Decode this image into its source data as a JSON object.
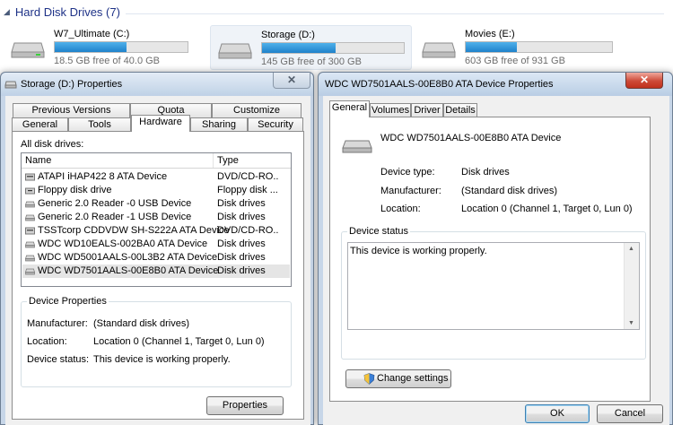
{
  "explorer": {
    "group_title": "Hard Disk Drives (7)",
    "drives": [
      {
        "name": "W7_Ultimate (C:)",
        "free_text": "18.5 GB free of 40.0 GB",
        "used_fraction": 0.54
      },
      {
        "name": "Storage (D:)",
        "free_text": "145 GB free of 300 GB",
        "used_fraction": 0.52
      },
      {
        "name": "Movies (E:)",
        "free_text": "603 GB free of 931 GB",
        "used_fraction": 0.35
      }
    ]
  },
  "storage_props": {
    "title": "Storage (D:) Properties",
    "close_label": "✕",
    "tabs_row1": [
      "Previous Versions",
      "Quota",
      "Customize"
    ],
    "tabs_row2": [
      "General",
      "Tools",
      "Hardware",
      "Sharing",
      "Security"
    ],
    "active_tab": "Hardware",
    "all_disk_drives_label": "All disk drives:",
    "columns": [
      "Name",
      "Type"
    ],
    "drives": [
      {
        "name": "ATAPI iHAP422   8 ATA Device",
        "type": "DVD/CD-RO...",
        "icon": "optical-drive-icon"
      },
      {
        "name": "Floppy disk drive",
        "type": "Floppy disk ...",
        "icon": "floppy-drive-icon"
      },
      {
        "name": "Generic 2.0 Reader   -0 USB Device",
        "type": "Disk drives",
        "icon": "disk-drive-icon"
      },
      {
        "name": "Generic 2.0 Reader   -1 USB Device",
        "type": "Disk drives",
        "icon": "disk-drive-icon"
      },
      {
        "name": "TSSTcorp CDDVDW SH-S222A ATA Device",
        "type": "DVD/CD-RO...",
        "icon": "optical-drive-icon"
      },
      {
        "name": "WDC WD10EALS-002BA0 ATA Device",
        "type": "Disk drives",
        "icon": "disk-drive-icon"
      },
      {
        "name": "WDC WD5001AALS-00L3B2 ATA Device",
        "type": "Disk drives",
        "icon": "disk-drive-icon"
      },
      {
        "name": "WDC WD7501AALS-00E8B0 ATA Device",
        "type": "Disk drives",
        "icon": "disk-drive-icon"
      }
    ],
    "selected_index": 7,
    "device_properties_label": "Device Properties",
    "manufacturer_label": "Manufacturer:",
    "manufacturer_value": "(Standard disk drives)",
    "location_label": "Location:",
    "location_value": "Location 0 (Channel 1, Target 0, Lun 0)",
    "status_label": "Device status:",
    "status_value": "This device is working properly.",
    "properties_button": "Properties"
  },
  "device_props": {
    "title": "WDC WD7501AALS-00E8B0 ATA Device Properties",
    "close_label": "✕",
    "tabs": [
      "General",
      "Volumes",
      "Driver",
      "Details"
    ],
    "active_tab": "General",
    "device_name": "WDC WD7501AALS-00E8B0 ATA Device",
    "device_type_label": "Device type:",
    "device_type_value": "Disk drives",
    "manufacturer_label": "Manufacturer:",
    "manufacturer_value": "(Standard disk drives)",
    "location_label": "Location:",
    "location_value": "Location 0 (Channel 1, Target 0, Lun 0)",
    "device_status_label": "Device status",
    "device_status_text": "This device is working properly.",
    "change_settings_button": "Change settings",
    "ok_button": "OK",
    "cancel_button": "Cancel"
  },
  "colors": {
    "explorer_group_text": "#1e3287",
    "bar_fill": "#2389d0",
    "close_red": "#c7402c"
  }
}
